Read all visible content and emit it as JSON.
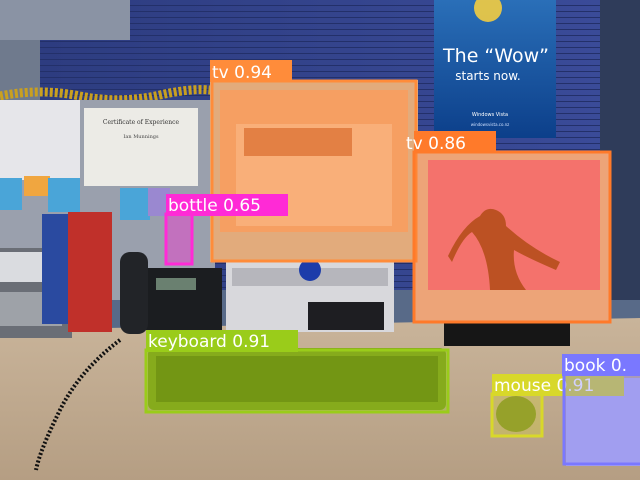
{
  "poster": {
    "headline_line1": "The “Wow”",
    "headline_line2": "starts now.",
    "brand": "Windows Vista",
    "url": "windowsvista.co.nz"
  },
  "certificate": {
    "title": "Certificate of Experience",
    "name": "Ian Munnings"
  },
  "detections": [
    {
      "class": "tv",
      "label": "tv 0.94",
      "confidence": 0.94,
      "color": "#ff8c3a"
    },
    {
      "class": "tv",
      "label": "tv 0.86",
      "confidence": 0.86,
      "color": "#ff7a2a"
    },
    {
      "class": "bottle",
      "label": "bottle 0.65",
      "confidence": 0.65,
      "color": "#ff2ad6"
    },
    {
      "class": "keyboard",
      "label": "keyboard 0.91",
      "confidence": 0.91,
      "color": "#9acc1a"
    },
    {
      "class": "mouse",
      "label": "mouse 0.91",
      "confidence": 0.91,
      "color": "#d8d82a"
    },
    {
      "class": "book",
      "label": "book 0.",
      "confidence": null,
      "color": "#7a78ff"
    }
  ]
}
